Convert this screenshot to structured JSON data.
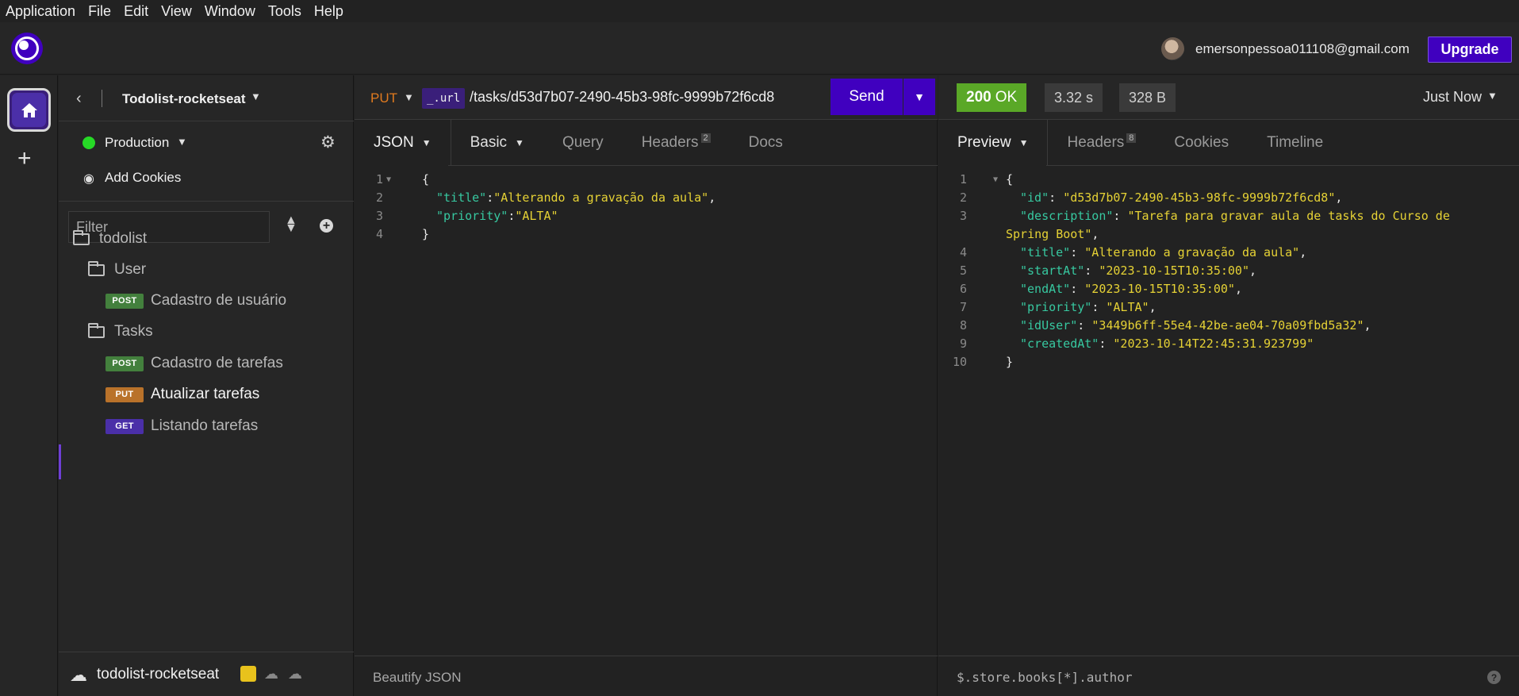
{
  "menu": [
    "Application",
    "File",
    "Edit",
    "View",
    "Window",
    "Tools",
    "Help"
  ],
  "header": {
    "user_email": "emersonpessoa011108@gmail.com",
    "upgrade_label": "Upgrade"
  },
  "sidebar": {
    "project_name": "Todolist-rocketseat",
    "environment": "Production",
    "add_cookies": "Add Cookies",
    "filter_placeholder": "Filter",
    "tree": [
      {
        "type": "folder",
        "label": "todolist"
      },
      {
        "type": "folder",
        "label": "User"
      },
      {
        "type": "request",
        "method": "POST",
        "label": "Cadastro de usuário"
      },
      {
        "type": "folder",
        "label": "Tasks"
      },
      {
        "type": "request",
        "method": "POST",
        "label": "Cadastro de tarefas"
      },
      {
        "type": "request",
        "method": "PUT",
        "label": "Atualizar tarefas",
        "active": true
      },
      {
        "type": "request",
        "method": "GET",
        "label": "Listando tarefas"
      }
    ],
    "footer_project": "todolist-rocketseat"
  },
  "request": {
    "method": "PUT",
    "url_var": "_.url",
    "url_path": "/tasks/d53d7b07-2490-45b3-98fc-9999b72f6cd8",
    "send_label": "Send",
    "tabs": [
      {
        "label": "JSON",
        "active": true,
        "caret": true
      },
      {
        "label": "Basic",
        "caret": true
      },
      {
        "label": "Query"
      },
      {
        "label": "Headers",
        "count": "2"
      },
      {
        "label": "Docs"
      }
    ],
    "body_lines": [
      {
        "n": "1",
        "text": "{"
      },
      {
        "n": "2",
        "key": "\"title\"",
        "sep": ":",
        "val": "\"Alterando a gravação da aula\"",
        "end": ","
      },
      {
        "n": "3",
        "key": "\"priority\"",
        "sep": ":",
        "val": "\"ALTA\"",
        "end": ""
      },
      {
        "n": "4",
        "text": "}"
      }
    ],
    "beautify_label": "Beautify JSON"
  },
  "response": {
    "status_code": "200",
    "status_text": "OK",
    "time": "3.32 s",
    "size": "328 B",
    "history": "Just Now",
    "tabs": [
      {
        "label": "Preview",
        "active": true,
        "caret": true
      },
      {
        "label": "Headers",
        "count": "8"
      },
      {
        "label": "Cookies"
      },
      {
        "label": "Timeline"
      }
    ],
    "lines": [
      {
        "n": "1",
        "text": "{"
      },
      {
        "n": "2",
        "key": "\"id\"",
        "val": "\"d53d7b07-2490-45b3-98fc-9999b72f6cd8\"",
        "end": ","
      },
      {
        "n": "3",
        "key": "\"description\"",
        "val": "\"Tarefa para gravar aula de tasks do Curso de",
        "end": ""
      },
      {
        "n": "",
        "cont": "Spring Boot\"",
        "end": ","
      },
      {
        "n": "4",
        "key": "\"title\"",
        "val": "\"Alterando a gravação da aula\"",
        "end": ","
      },
      {
        "n": "5",
        "key": "\"startAt\"",
        "val": "\"2023-10-15T10:35:00\"",
        "end": ","
      },
      {
        "n": "6",
        "key": "\"endAt\"",
        "val": "\"2023-10-15T10:35:00\"",
        "end": ","
      },
      {
        "n": "7",
        "key": "\"priority\"",
        "val": "\"ALTA\"",
        "end": ","
      },
      {
        "n": "8",
        "key": "\"idUser\"",
        "val": "\"3449b6ff-55e4-42be-ae04-70a09fbd5a32\"",
        "end": ","
      },
      {
        "n": "9",
        "key": "\"createdAt\"",
        "val": "\"2023-10-14T22:45:31.923799\"",
        "end": ""
      },
      {
        "n": "10",
        "text": "}"
      }
    ],
    "jsonpath_placeholder": "$.store.books[*].author"
  }
}
